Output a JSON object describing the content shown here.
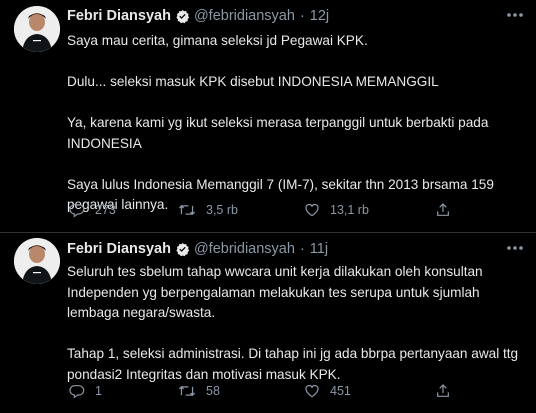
{
  "tweets": [
    {
      "author": "Febri Diansyah",
      "handle": "@febridiansyah",
      "separator": "·",
      "time": "12j",
      "paragraphs": [
        "Saya mau cerita, gimana seleksi jd Pegawai KPK.",
        "Dulu... seleksi masuk KPK disebut INDONESIA MEMANGGIL",
        "Ya, karena kami yg ikut seleksi merasa terpanggil untuk berbakti pada INDONESIA",
        "Saya lulus Indonesia Memanggil 7 (IM-7), sekitar thn 2013 brsama 159 pegawai lainnya."
      ],
      "reply_count": "273",
      "retweet_count": "3,5 rb",
      "like_count": "13,1 rb"
    },
    {
      "author": "Febri Diansyah",
      "handle": "@febridiansyah",
      "separator": "·",
      "time": "11j",
      "paragraphs": [
        "Seluruh tes sbelum tahap wwcara unit kerja dilakukan oleh konsultan Independen yg berpengalaman melakukan tes serupa untuk sjumlah lembaga negara/swasta.",
        "Tahap 1, seleksi administrasi. Di tahap ini jg ada bbrpa pertanyaan awal ttg pondasi2 Integritas dan motivasi masuk KPK."
      ],
      "reply_count": "1",
      "retweet_count": "58",
      "like_count": "451"
    }
  ],
  "icons": {
    "verified": "verified-badge-icon",
    "more": "more-options-icon",
    "reply": "reply-icon",
    "retweet": "retweet-icon",
    "like": "like-icon",
    "share": "share-icon"
  },
  "colors": {
    "background": "#000000",
    "text": "#e7e9ea",
    "muted": "#8b98a5",
    "verified": "#e7e9ea",
    "divider": "#2f3336"
  }
}
